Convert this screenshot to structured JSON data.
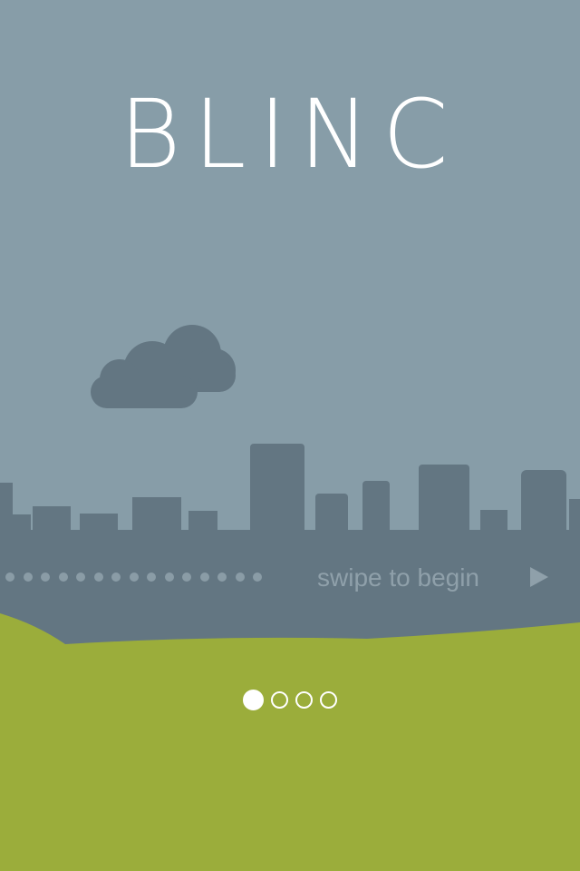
{
  "app": {
    "logo_text": "BLINC",
    "logo_mark": "*"
  },
  "onboarding": {
    "swipe_label": "swipe to begin",
    "swipe_icon": "play-arrow-icon",
    "current_page": 1,
    "total_pages": 4
  },
  "colors": {
    "sky": "#879da8",
    "skyline": "#637682",
    "cloud": "#637682",
    "grass": "#9bad3b",
    "text": "#ffffff"
  }
}
